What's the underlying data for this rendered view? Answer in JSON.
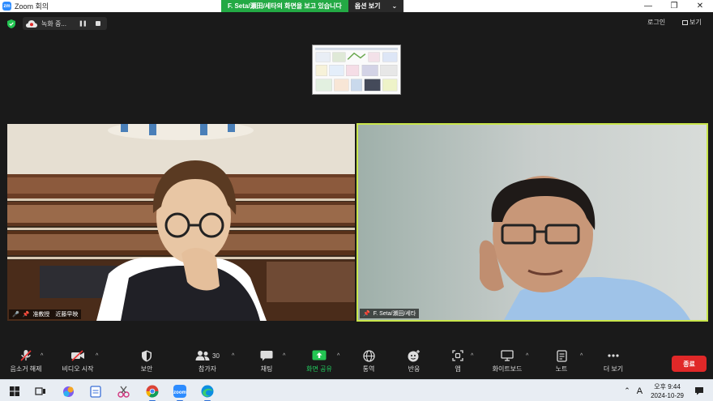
{
  "window": {
    "title": "Zoom 회의",
    "logo_text": "zm"
  },
  "share_banner": {
    "message": "F. Seta/瀬田/세타의 화면을 보고 있습니다",
    "options_label": "옵션 보기"
  },
  "recording": {
    "label": "녹화 중..."
  },
  "top_right": {
    "login": "로그인",
    "view": "보기"
  },
  "participants": [
    {
      "name": "准教授　近藤早映",
      "muted": true
    },
    {
      "name": "F. Seta/瀬田/세타",
      "muted": false,
      "active_speaker": true
    }
  ],
  "toolbar": {
    "items": [
      {
        "id": "mute",
        "label": "음소거 해제",
        "icon": "mic-off-icon",
        "has_caret": true
      },
      {
        "id": "video",
        "label": "비디오 시작",
        "icon": "video-off-icon",
        "has_caret": true
      },
      {
        "id": "security",
        "label": "보안",
        "icon": "shield-icon",
        "has_caret": false
      },
      {
        "id": "participants",
        "label": "참가자",
        "icon": "participants-icon",
        "count": "30",
        "has_caret": true
      },
      {
        "id": "chat",
        "label": "채팅",
        "icon": "chat-icon",
        "has_caret": true
      },
      {
        "id": "share",
        "label": "화면 공유",
        "icon": "share-screen-icon",
        "has_caret": true
      },
      {
        "id": "translate",
        "label": "통역",
        "icon": "globe-icon",
        "has_caret": false
      },
      {
        "id": "reactions",
        "label": "반응",
        "icon": "reaction-icon",
        "has_caret": false
      },
      {
        "id": "apps",
        "label": "앱",
        "icon": "apps-icon",
        "has_caret": true
      },
      {
        "id": "whiteboard",
        "label": "화이트보드",
        "icon": "whiteboard-icon",
        "has_caret": true
      },
      {
        "id": "notes",
        "label": "노트",
        "icon": "notes-icon",
        "has_caret": true
      },
      {
        "id": "more",
        "label": "더 보기",
        "icon": "more-icon",
        "has_caret": false
      }
    ],
    "end_label": "종료"
  },
  "taskbar": {
    "apps": [
      "windows-start-icon",
      "task-view-icon",
      "copilot-icon",
      "notepad-icon",
      "snipping-icon",
      "chrome-icon",
      "zoom-icon",
      "edge-icon"
    ],
    "lang": "A",
    "time": "오후 9:44",
    "date": "2024-10-29"
  },
  "colors": {
    "accent_green": "#23a944",
    "active_border": "#c9e64b",
    "end_red": "#e02828",
    "zoom_blue": "#2d8cff"
  }
}
